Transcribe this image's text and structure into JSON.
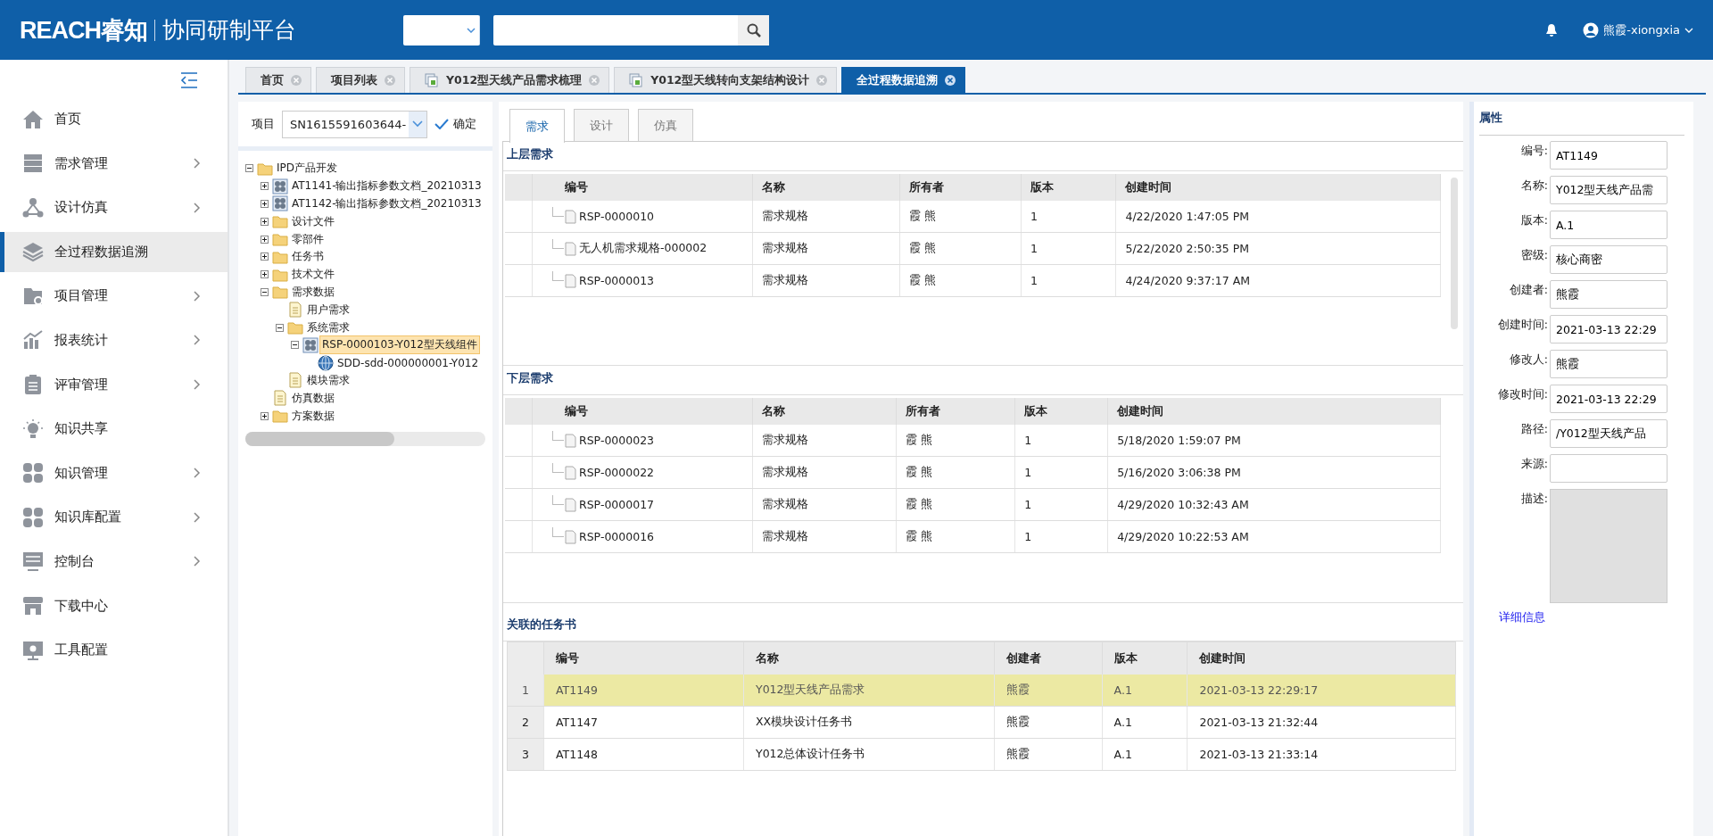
{
  "header": {
    "brand": "REACH睿知",
    "product": "协同研制平台",
    "user": "熊霞-xiongxia"
  },
  "sidebar": {
    "items": [
      {
        "label": "首页",
        "kind": "home",
        "has_submenu": false,
        "selected": false
      },
      {
        "label": "需求管理",
        "kind": "server",
        "has_submenu": true,
        "selected": false
      },
      {
        "label": "设计仿真",
        "kind": "nodes",
        "has_submenu": true,
        "selected": false
      },
      {
        "label": "全过程数据追溯",
        "kind": "layers",
        "has_submenu": false,
        "selected": true
      },
      {
        "label": "项目管理",
        "kind": "project",
        "has_submenu": true,
        "selected": false
      },
      {
        "label": "报表统计",
        "kind": "chart",
        "has_submenu": true,
        "selected": false
      },
      {
        "label": "评审管理",
        "kind": "clipboard",
        "has_submenu": true,
        "selected": false
      },
      {
        "label": "知识共享",
        "kind": "bulb",
        "has_submenu": false,
        "selected": false
      },
      {
        "label": "知识管理",
        "kind": "tiles",
        "has_submenu": true,
        "selected": false
      },
      {
        "label": "知识库配置",
        "kind": "tiles",
        "has_submenu": true,
        "selected": false
      },
      {
        "label": "控制台",
        "kind": "sliders",
        "has_submenu": true,
        "selected": false
      },
      {
        "label": "下载中心",
        "kind": "store",
        "has_submenu": false,
        "selected": false
      },
      {
        "label": "工具配置",
        "kind": "monitor",
        "has_submenu": false,
        "selected": false
      }
    ]
  },
  "open_tabs": [
    {
      "label": "首页",
      "kind": "plain",
      "selected": false
    },
    {
      "label": "项目列表",
      "kind": "plain",
      "selected": false
    },
    {
      "label": "Y012型天线产品需求梳理",
      "kind": "document",
      "selected": false
    },
    {
      "label": "Y012型天线转向支架结构设计",
      "kind": "document",
      "selected": false
    },
    {
      "label": "全过程数据追溯",
      "kind": "plain",
      "selected": true
    }
  ],
  "project_picker": {
    "label": "项目",
    "value": "SN1615591603644-",
    "confirm": "确定"
  },
  "tree": {
    "nodes": [
      {
        "label": "IPD产品开发",
        "kind": "folder",
        "expanded": true,
        "selected": false,
        "children": [
          {
            "label": "AT1141-输出指标参数文档_20210313",
            "kind": "assembly",
            "expanded": false,
            "selected": false
          },
          {
            "label": "AT1142-输出指标参数文档_20210313",
            "kind": "assembly",
            "expanded": false,
            "selected": false
          },
          {
            "label": "设计文件",
            "kind": "folder",
            "expanded": false,
            "selected": false
          },
          {
            "label": "零部件",
            "kind": "folder",
            "expanded": false,
            "selected": false
          },
          {
            "label": "任务书",
            "kind": "folder",
            "expanded": false,
            "selected": false
          },
          {
            "label": "技术文件",
            "kind": "folder",
            "expanded": false,
            "selected": false
          },
          {
            "label": "需求数据",
            "kind": "folder",
            "expanded": true,
            "selected": false,
            "children": [
              {
                "label": "用户需求",
                "kind": "doc",
                "selected": false
              },
              {
                "label": "系统需求",
                "kind": "folder",
                "expanded": true,
                "selected": false,
                "children": [
                  {
                    "label": "RSP-0000103-Y012型天线组件",
                    "kind": "assembly",
                    "expanded": true,
                    "selected": true,
                    "children": [
                      {
                        "label": "SDD-sdd-000000001-Y012",
                        "kind": "globe",
                        "selected": false
                      }
                    ]
                  }
                ]
              },
              {
                "label": "模块需求",
                "kind": "doc",
                "selected": false
              }
            ]
          },
          {
            "label": "仿真数据",
            "kind": "doc",
            "selected": false
          },
          {
            "label": "方案数据",
            "kind": "folder",
            "expanded": false,
            "selected": false
          }
        ]
      }
    ]
  },
  "content_tabs": [
    {
      "label": "需求",
      "selected": true
    },
    {
      "label": "设计",
      "selected": false
    },
    {
      "label": "仿真",
      "selected": false
    }
  ],
  "upper_requirements": {
    "title": "上层需求",
    "columns": [
      "编号",
      "名称",
      "所有者",
      "版本",
      "创建时间"
    ],
    "rows": [
      {
        "cells": [
          "RSP-0000010",
          "需求规格",
          "霞 熊",
          "1",
          "4/22/2020 1:47:05 PM"
        ]
      },
      {
        "cells": [
          "无人机需求规格-000002",
          "需求规格",
          "霞 熊",
          "1",
          "5/22/2020 2:50:35 PM"
        ]
      },
      {
        "cells": [
          "RSP-0000013",
          "需求规格",
          "霞 熊",
          "1",
          "4/24/2020 9:37:17 AM"
        ]
      }
    ]
  },
  "lower_requirements": {
    "title": "下层需求",
    "columns": [
      "编号",
      "名称",
      "所有者",
      "版本",
      "创建时间"
    ],
    "rows": [
      {
        "cells": [
          "RSP-0000023",
          "需求规格",
          "霞 熊",
          "1",
          "5/18/2020 1:59:07 PM"
        ]
      },
      {
        "cells": [
          "RSP-0000022",
          "需求规格",
          "霞 熊",
          "1",
          "5/16/2020 3:06:38 PM"
        ]
      },
      {
        "cells": [
          "RSP-0000017",
          "需求规格",
          "霞 熊",
          "1",
          "4/29/2020 10:32:43 AM"
        ]
      },
      {
        "cells": [
          "RSP-0000016",
          "需求规格",
          "霞 熊",
          "1",
          "4/29/2020 10:22:53 AM"
        ]
      }
    ]
  },
  "related_tasks": {
    "title": "关联的任务书",
    "columns": [
      "编号",
      "名称",
      "创建者",
      "版本",
      "创建时间"
    ],
    "rows": [
      {
        "index": "1",
        "cells": [
          "AT1149",
          "Y012型天线产品需求",
          "熊霞",
          "A.1",
          "2021-03-13 22:29:17"
        ],
        "selected": true
      },
      {
        "index": "2",
        "cells": [
          "AT1147",
          "XX模块设计任务书",
          "熊霞",
          "A.1",
          "2021-03-13 21:32:44"
        ],
        "selected": false
      },
      {
        "index": "3",
        "cells": [
          "AT1148",
          "Y012总体设计任务书",
          "熊霞",
          "A.1",
          "2021-03-13 21:33:14"
        ],
        "selected": false
      }
    ]
  },
  "properties": {
    "title": "属性",
    "fields": [
      {
        "label": "编号:",
        "kind": "text",
        "value": "AT1149"
      },
      {
        "label": "名称:",
        "kind": "text",
        "value": "Y012型天线产品需"
      },
      {
        "label": "版本:",
        "kind": "text",
        "value": "A.1"
      },
      {
        "label": "密级:",
        "kind": "text",
        "value": "核心商密"
      },
      {
        "label": "创建者:",
        "kind": "text",
        "value": "熊霞"
      },
      {
        "label": "创建时间:",
        "kind": "text",
        "value": "2021-03-13 22:29"
      },
      {
        "label": "修改人:",
        "kind": "text",
        "value": "熊霞"
      },
      {
        "label": "修改时间:",
        "kind": "text",
        "value": "2021-03-13 22:29"
      },
      {
        "label": "路径:",
        "kind": "text",
        "value": "/Y012型天线产品"
      },
      {
        "label": "来源:",
        "kind": "text"
      },
      {
        "label": "描述:",
        "kind": "textarea"
      }
    ],
    "link": "详细信息"
  }
}
